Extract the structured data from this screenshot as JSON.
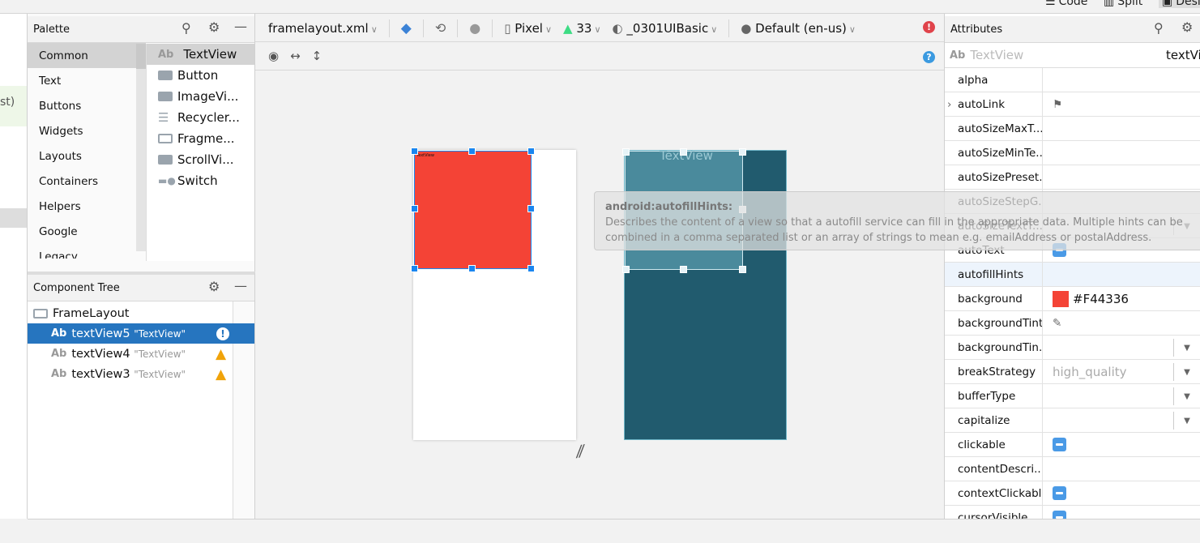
{
  "view_modes": [
    "Code",
    "Split",
    "Design"
  ],
  "editor_fragment": "st)",
  "palette": {
    "title": "Palette",
    "categories": [
      "Common",
      "Text",
      "Buttons",
      "Widgets",
      "Layouts",
      "Containers",
      "Helpers",
      "Google",
      "Legacy"
    ],
    "items": [
      {
        "label": "TextView",
        "icon": "textview-icon"
      },
      {
        "label": "Button",
        "icon": "button-icon"
      },
      {
        "label": "ImageVi...",
        "icon": "image-icon"
      },
      {
        "label": "Recycler...",
        "icon": "list-icon"
      },
      {
        "label": "Fragme...",
        "icon": "fragment-icon"
      },
      {
        "label": "ScrollVi...",
        "icon": "scrollview-icon"
      },
      {
        "label": "Switch",
        "icon": "switch-icon"
      }
    ]
  },
  "component_tree": {
    "title": "Component Tree",
    "root": "FrameLayout",
    "nodes": [
      {
        "id": "textView5",
        "text": "\"TextView\"",
        "status": "error",
        "selected": true
      },
      {
        "id": "textView4",
        "text": "\"TextView\"",
        "status": "warning"
      },
      {
        "id": "textView3",
        "text": "\"TextView\"",
        "status": "warning"
      }
    ]
  },
  "toolbar": {
    "file": "framelayout.xml",
    "device": "Pixel",
    "api": "33",
    "theme": "_0301UIBasic",
    "locale": "Default (en-us)"
  },
  "canvas": {
    "blueprint_label": "TextView",
    "design_text": "TextView"
  },
  "tooltip": {
    "title": "android:autofillHints:",
    "body": "Describes the content of a view so that a autofill service can fill in the appropriate data. Multiple hints can be combined in a comma separated list or an array of strings to mean e.g. emailAddress or postalAddress."
  },
  "attributes": {
    "title": "Attributes",
    "type": "TextView",
    "id": "textVi",
    "rows": [
      {
        "name": "alpha"
      },
      {
        "name": "autoLink",
        "kind": "flag",
        "expand": true
      },
      {
        "name": "autoSizeMaxT..."
      },
      {
        "name": "autoSizeMinTe..."
      },
      {
        "name": "autoSizePreset..."
      },
      {
        "name": "autoSizeStepG..."
      },
      {
        "name": "autoSizeTextT...",
        "kind": "dropdown"
      },
      {
        "name": "autoText",
        "kind": "toggle"
      },
      {
        "name": "autofillHints",
        "highlight": true
      },
      {
        "name": "background",
        "kind": "color",
        "value": "#F44336"
      },
      {
        "name": "backgroundTint",
        "kind": "picker"
      },
      {
        "name": "backgroundTin...",
        "kind": "dropdown"
      },
      {
        "name": "breakStrategy",
        "kind": "dropdown",
        "value": "high_quality"
      },
      {
        "name": "bufferType",
        "kind": "dropdown"
      },
      {
        "name": "capitalize",
        "kind": "dropdown"
      },
      {
        "name": "clickable",
        "kind": "toggle"
      },
      {
        "name": "contentDescri..."
      },
      {
        "name": "contextClickable",
        "kind": "toggle"
      },
      {
        "name": "cursorVisible",
        "kind": "toggle"
      }
    ]
  },
  "colors": {
    "selection": "#2675bf",
    "red": "#F44336",
    "blueprint": "#215b6e",
    "handle": "#1a86f0"
  }
}
